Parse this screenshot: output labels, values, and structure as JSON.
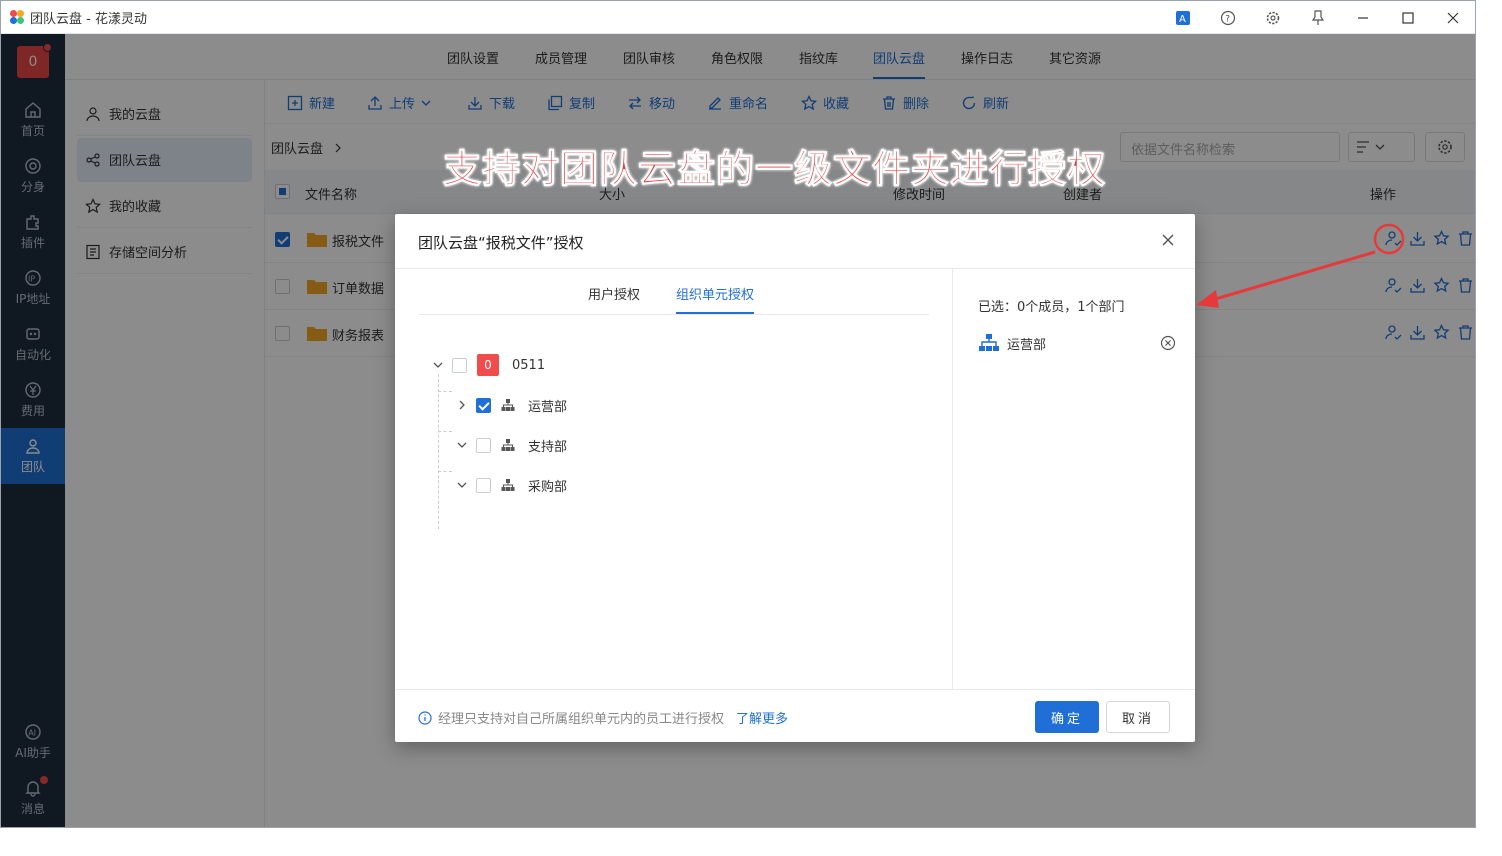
{
  "window": {
    "title": "团队云盘 - 花漾灵动"
  },
  "leftbar": {
    "team_avatar": "0",
    "items": [
      {
        "label": "首页",
        "icon": "home-icon"
      },
      {
        "label": "分身",
        "icon": "browser-icon"
      },
      {
        "label": "插件",
        "icon": "plugin-icon"
      },
      {
        "label": "IP地址",
        "icon": "ip-icon"
      },
      {
        "label": "自动化",
        "icon": "robot-icon"
      },
      {
        "label": "费用",
        "icon": "yuan-icon"
      },
      {
        "label": "团队",
        "icon": "team-icon"
      },
      {
        "label": "AI助手",
        "icon": "ai-icon"
      },
      {
        "label": "消息",
        "icon": "bell-icon"
      }
    ]
  },
  "topnav": {
    "tabs": [
      "团队设置",
      "成员管理",
      "团队审核",
      "角色权限",
      "指纹库",
      "团队云盘",
      "操作日志",
      "其它资源"
    ],
    "active": "团队云盘"
  },
  "subside": {
    "items": [
      "我的云盘",
      "团队云盘",
      "我的收藏",
      "存储空间分析"
    ],
    "active": "团队云盘"
  },
  "toolbar": {
    "new": "新建",
    "upload": "上传",
    "download": "下载",
    "copy": "复制",
    "move": "移动",
    "rename": "重命名",
    "favorite": "收藏",
    "delete": "删除",
    "refresh": "刷新"
  },
  "breadcrumb": {
    "root": "团队云盘"
  },
  "search": {
    "placeholder": "依据文件名称检索"
  },
  "table": {
    "headers": {
      "name": "文件名称",
      "size": "大小",
      "modified": "修改时间",
      "creator": "创建者",
      "actions": "操作"
    },
    "rows": [
      {
        "name": "报税文件",
        "checked": true
      },
      {
        "name": "订单数据",
        "checked": false
      },
      {
        "name": "财务报表",
        "checked": false
      }
    ]
  },
  "banner": "支持对团队云盘的一级文件夹进行授权",
  "dialog": {
    "title": "团队云盘“报税文件”授权",
    "tabs": [
      "用户授权",
      "组织单元授权"
    ],
    "active_tab": "组织单元授权",
    "tree": {
      "root": {
        "badge": "0",
        "label": "0511"
      },
      "children": [
        {
          "label": "运营部",
          "checked": true
        },
        {
          "label": "支持部",
          "checked": false
        },
        {
          "label": "采购部",
          "checked": false
        }
      ]
    },
    "selected_summary": "已选：0个成员，1个部门",
    "selected": [
      {
        "label": "运营部"
      }
    ],
    "footer_note": "经理只支持对自己所属组织单元内的员工进行授权",
    "footer_link": "了解更多",
    "ok": "确定",
    "cancel": "取消"
  },
  "colors": {
    "primary": "#1f6fd6",
    "sidebar": "#1e2d3f",
    "danger": "#f24b4b",
    "folder": "#f5a623"
  }
}
